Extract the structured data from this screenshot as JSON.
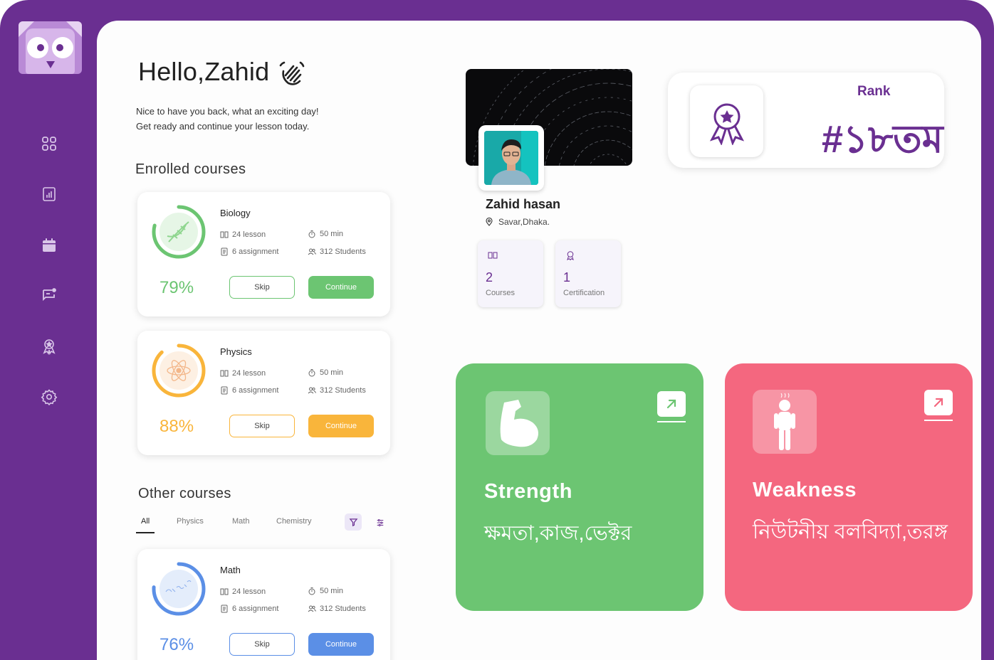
{
  "colors": {
    "brand": "#6a2f91",
    "green": "#6cc572",
    "orange": "#f9b53b",
    "blue": "#5b8fe6",
    "pink": "#f4677f"
  },
  "sidebar": {
    "nav_icons": [
      "grid-icon",
      "chart-icon",
      "calendar-icon",
      "chat-icon",
      "award-icon",
      "settings-icon"
    ]
  },
  "header": {
    "greeting": "Hello,Zahid",
    "subtitle_line1": "Nice to have you back, what an exciting day!",
    "subtitle_line2": "Get ready and continue your lesson today."
  },
  "enrolled": {
    "title": "Enrolled courses",
    "courses": [
      {
        "name": "Biology",
        "lessons": "24 lesson",
        "duration": "50 min",
        "assignments": "6 assignment",
        "students": "312 Students",
        "progress_text": "79%",
        "progress": 0.79,
        "skip_label": "Skip",
        "continue_label": "Continue"
      },
      {
        "name": "Physics",
        "lessons": "24 lesson",
        "duration": "50 min",
        "assignments": "6 assignment",
        "students": "312 Students",
        "progress_text": "88%",
        "progress": 0.88,
        "skip_label": "Skip",
        "continue_label": "Continue"
      }
    ]
  },
  "other": {
    "title": "Other courses",
    "tabs": [
      "All",
      "Physics",
      "Math",
      "Chemistry"
    ],
    "active_tab": "All",
    "courses": [
      {
        "name": "Math",
        "lessons": "24 lesson",
        "duration": "50 min",
        "assignments": "6 assignment",
        "students": "312 Students",
        "progress_text": "76%",
        "progress": 0.76,
        "skip_label": "Skip",
        "continue_label": "Continue"
      }
    ]
  },
  "profile": {
    "name": "Zahid hasan",
    "location": "Savar,Dhaka.",
    "stats": [
      {
        "value": "2",
        "label": "Courses"
      },
      {
        "value": "1",
        "label": "Certification"
      }
    ]
  },
  "rank": {
    "label": "Rank",
    "value": "#১৮তম"
  },
  "strength": {
    "title": "Strength",
    "text": "ক্ষমতা,কাজ,ভেক্টর"
  },
  "weakness": {
    "title": "Weakness",
    "text": "নিউটনীয় বলবিদ্যা,তরঙ্গ"
  }
}
